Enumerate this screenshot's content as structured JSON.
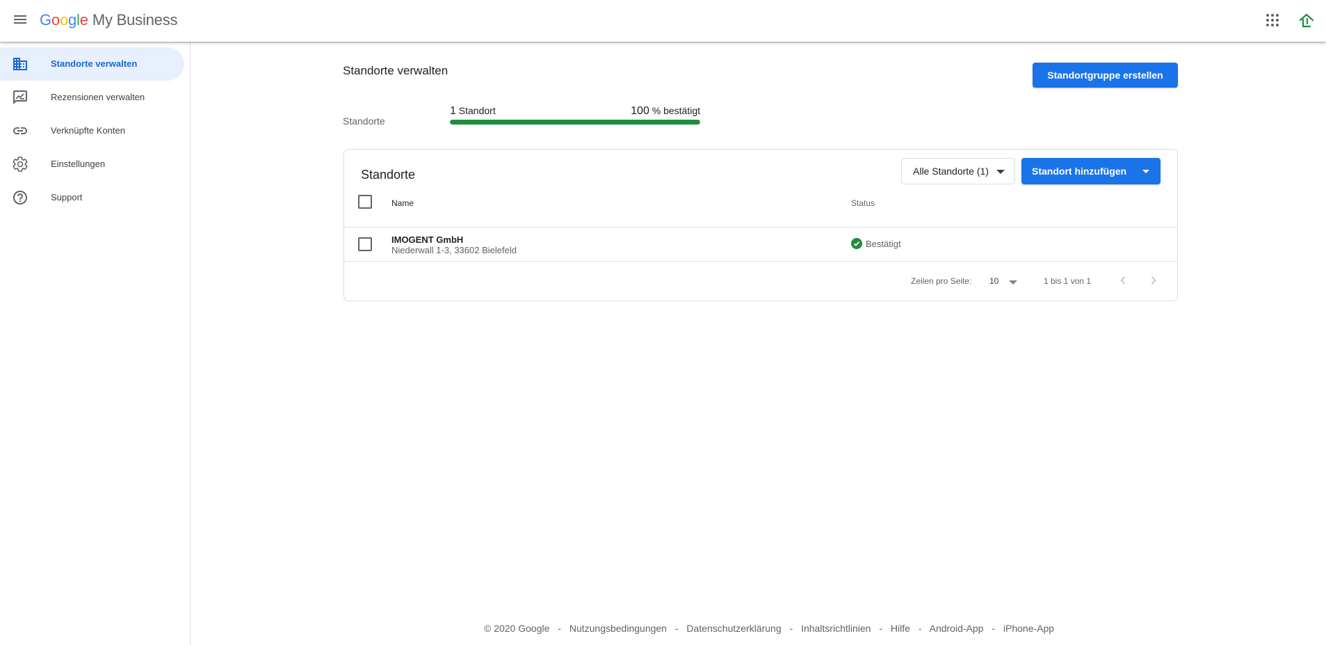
{
  "header": {
    "logo_letters": [
      "G",
      "o",
      "o",
      "g",
      "l",
      "e"
    ],
    "product": "My Business",
    "icons": {
      "menu": "menu-icon",
      "apps": "apps-grid-icon",
      "account": "account-avatar-icon"
    }
  },
  "sidebar": {
    "items": [
      {
        "label": "Standorte verwalten",
        "icon": "building-icon",
        "active": true
      },
      {
        "label": "Rezensionen verwalten",
        "icon": "reviews-icon",
        "active": false
      },
      {
        "label": "Verknüpfte Konten",
        "icon": "link-icon",
        "active": false
      },
      {
        "label": "Einstellungen",
        "icon": "gear-icon",
        "active": false
      },
      {
        "label": "Support",
        "icon": "help-icon",
        "active": false
      }
    ]
  },
  "main": {
    "title": "Standorte verwalten",
    "create_group_button": "Standortgruppe erstellen",
    "summary": {
      "label": "Standorte",
      "count_number": "1",
      "count_unit": "Standort",
      "percent_number": "100",
      "percent_suffix": "% bestätigt",
      "verified_fraction": 1.0
    },
    "card": {
      "title": "Standorte",
      "filter_button": "Alle Standorte (1)",
      "add_button": "Standort hinzufügen",
      "columns": {
        "name": "Name",
        "status": "Status"
      },
      "rows": [
        {
          "name": "IMOGENT GmbH",
          "address": "Niederwall 1-3, 33602 Bielefeld",
          "status": "Bestätigt"
        }
      ],
      "pagination": {
        "rows_per_page_label": "Zeilen pro Seite:",
        "rows_per_page_value": "10",
        "range_text": "1 bis 1 von 1"
      }
    }
  },
  "footer": {
    "copyright": "© 2020 Google",
    "links": [
      "Nutzungsbedingungen",
      "Datenschutzerklärung",
      "Inhaltsrichtlinien",
      "Hilfe",
      "Android-App",
      "iPhone-App"
    ],
    "separator": "-"
  },
  "colors": {
    "primary": "#1a73e8",
    "active_nav_bg": "#e8f0fe",
    "active_nav_text": "#1967d2",
    "progress_green": "#1e8e3e",
    "status_green": "#1e8e3e"
  }
}
